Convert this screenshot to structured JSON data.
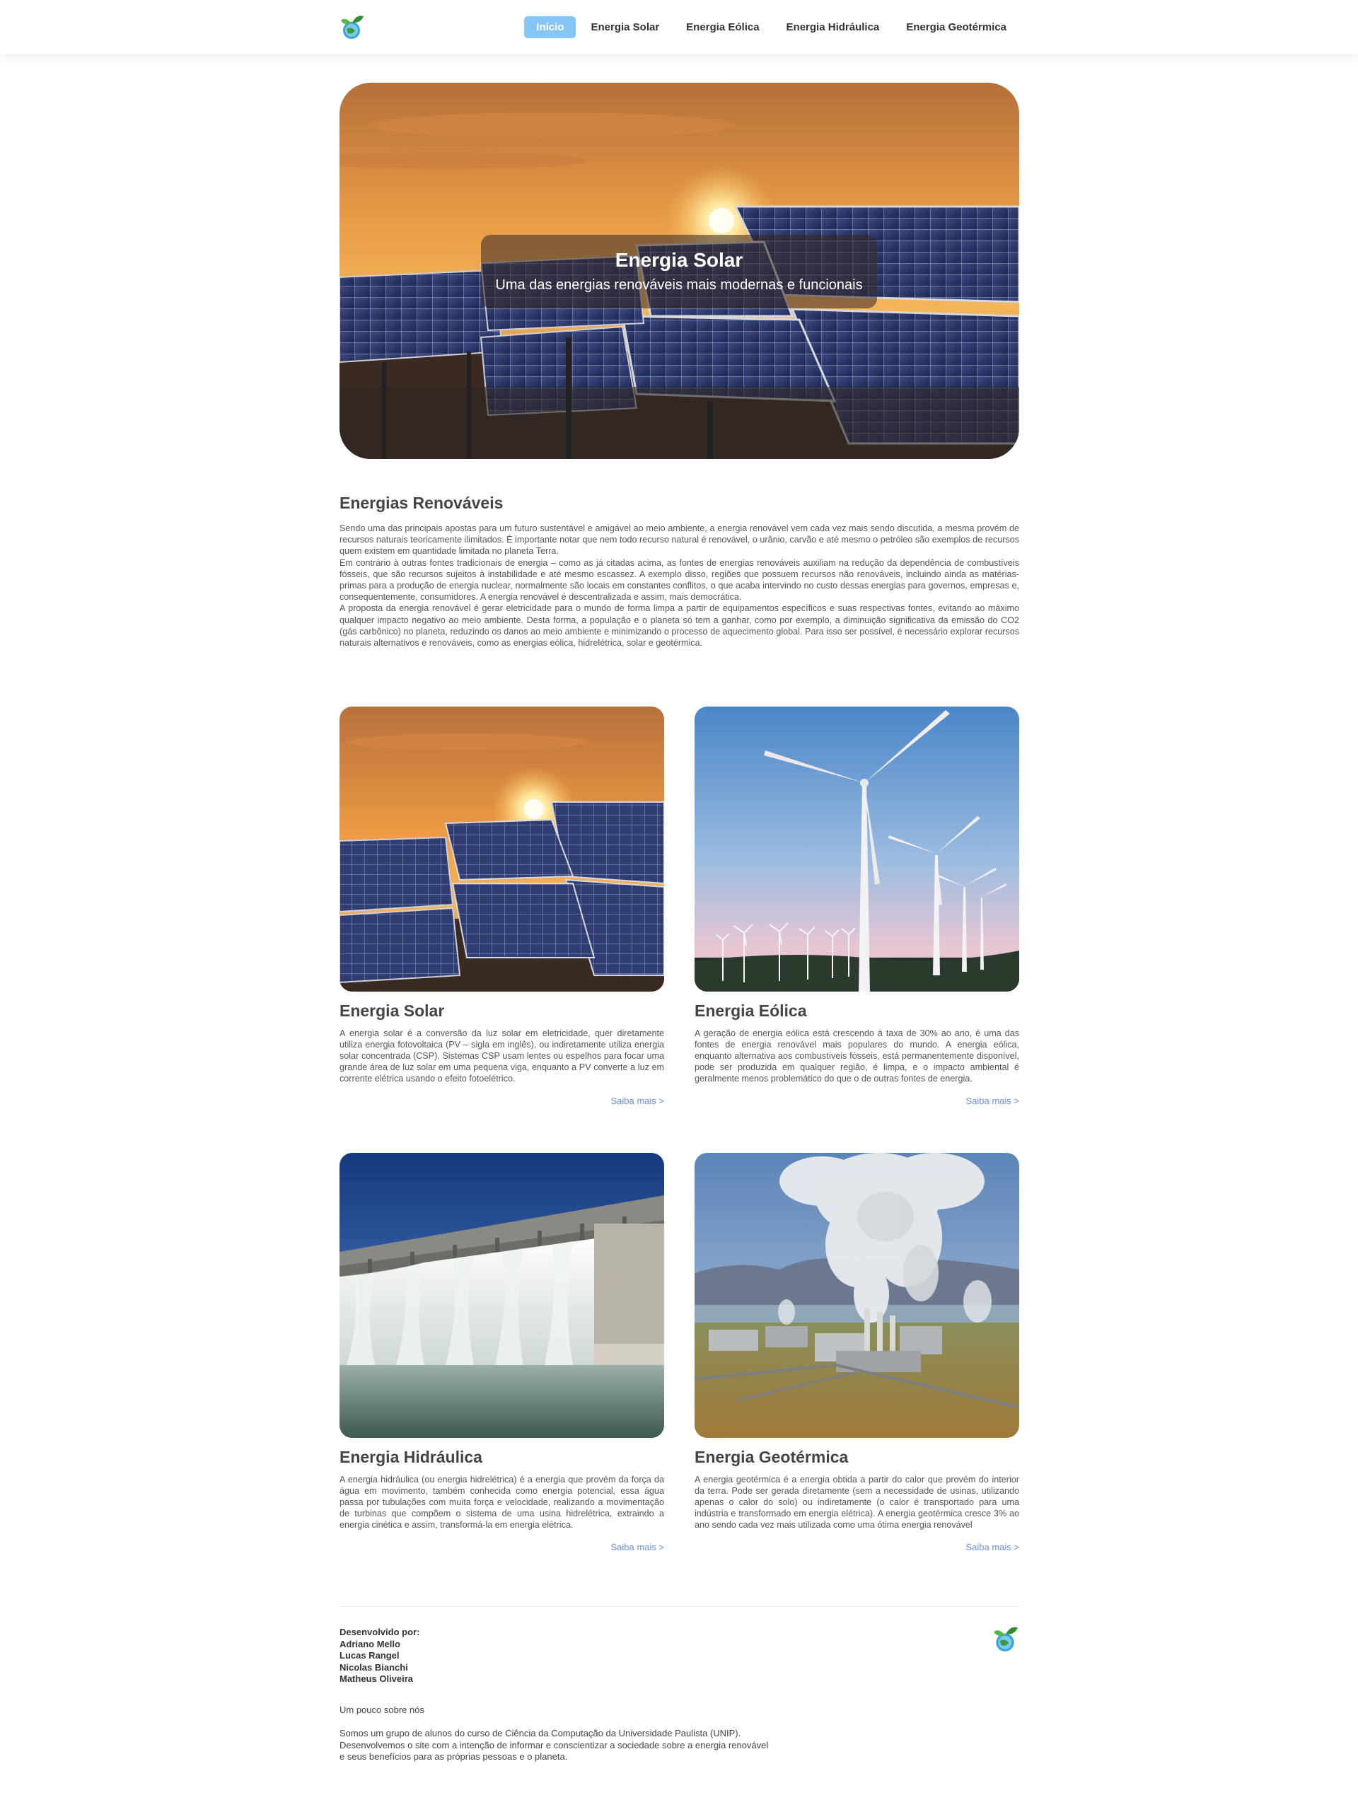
{
  "nav": {
    "links": [
      {
        "label": "Início",
        "active": true
      },
      {
        "label": "Energia Solar",
        "active": false
      },
      {
        "label": "Energia Eólica",
        "active": false
      },
      {
        "label": "Energia Hidráulica",
        "active": false
      },
      {
        "label": "Energia Geotérmica",
        "active": false
      }
    ]
  },
  "hero": {
    "title": "Energia Solar",
    "subtitle": "Uma das energias renováveis mais modernas e funcionais"
  },
  "intro": {
    "title": "Energias Renováveis",
    "paragraphs": [
      "Sendo uma das principais apostas para um futuro sustentável e amigável ao meio ambiente, a energia renovável vem cada vez mais sendo discutida, a mesma provém de recursos naturais teoricamente ilimitados. É importante notar que nem todo recurso natural é renovável, o urânio, carvão e até mesmo o petróleo são exemplos de recursos quem existem em quantidade limitada no planeta Terra.",
      "Em contrário à outras fontes tradicionais de energia – como as já citadas acima, as fontes de energias renováveis auxiliam na redução da dependência de combustíveis fósseis, que são recursos sujeitos à instabilidade e até mesmo escassez. A exemplo disso, regiões que possuem recursos não renováveis, incluindo ainda as matérias-primas para a produção de energia nuclear, normalmente são locais em constantes conflitos, o que acaba intervindo no custo dessas energias para governos, empresas e, consequentemente, consumidores. A energia renovável é descentralizada e assim, mais democrática.",
      "A proposta da energia renovável é gerar eletricidade para o mundo de forma limpa a partir de equipamentos específicos e suas respectivas fontes, evitando ao máximo qualquer impacto negativo ao meio ambiente. Desta forma, a população e o planeta só tem a ganhar, como por exemplo, a diminuição significativa da emissão do CO2 (gás carbônico) no planeta, reduzindo os danos ao meio ambiente e minimizando o processo de aquecimento global. Para isso ser possível, é necessário explorar recursos naturais alternativos e renováveis, como as energias eólica, hidrelétrica, solar e geotérmica."
    ]
  },
  "cards": [
    {
      "title": "Energia Solar",
      "text": "A energia solar é a conversão da luz solar em eletricidade, quer diretamente utiliza energia fotovoltaica (PV – sigla em inglês), ou indiretamente utiliza energia solar concentrada (CSP). Sistemas CSP usam lentes ou espelhos para focar uma grande área de luz solar em uma pequena viga, enquanto a PV converte a luz em corrente elétrica usando o efeito fotoelétrico.",
      "link": "Saiba mais >"
    },
    {
      "title": "Energia Eólica",
      "text": "A geração de energia eólica está crescendo à taxa de 30% ao ano, é uma das fontes de energia renovável mais populares do mundo. A energia eólica, enquanto alternativa aos combustíveis fósseis, está permanentemente disponível, pode ser produzida em qualquer região, é limpa, e o impacto ambiental é geralmente menos problemático do que o de outras fontes de energia.",
      "link": "Saiba mais >"
    },
    {
      "title": "Energia Hidráulica",
      "text": "A energia hidráulica (ou energia hidrelétrica) é a energia que provém da força da água em movimento, também conhecida como energia potencial, essa água passa por tubulações com muita força e velocidade, realizando a movimentação de turbinas que compõem o sistema de uma usina hidrelétrica, extraindo a energia cinética e assim, transformá-la em energia elétrica.",
      "link": "Saiba mais >"
    },
    {
      "title": "Energia Geotérmica",
      "text": "A energia geotérmica é a energia obtida a partir do calor que provém do interior da terra. Pode ser gerada diretamente (sem a necessidade de usinas, utilizando apenas o calor do solo) ou indiretamente (o calor é transportado para uma indústria e transformado em energia elétrica). A energia geotérmica cresce 3% ao ano sendo cada vez mais utilizada como uma ótima energia renovável",
      "link": "Saiba mais >"
    }
  ],
  "footer": {
    "developed_by": "Desenvolvido por:",
    "developers": [
      "Adriano Mello",
      "Lucas Rangel",
      "Nicolas Bianchi",
      "Matheus Oliveira"
    ],
    "about_title": "Um pouco sobre nós",
    "about_lines": [
      "Somos um grupo de alunos do curso de Ciência da Computação da Universidade Paulista (UNIP).",
      "Desenvolvemos o site com a intenção de informar e conscientizar a sociedade sobre a energia renovável",
      "e seus benefícios para as próprias pessoas e o planeta."
    ]
  },
  "colors": {
    "nav_active": "#86c6f7",
    "link": "#6a8fe8",
    "text": "#444444"
  },
  "icons": [
    "leaf-globe-logo"
  ]
}
